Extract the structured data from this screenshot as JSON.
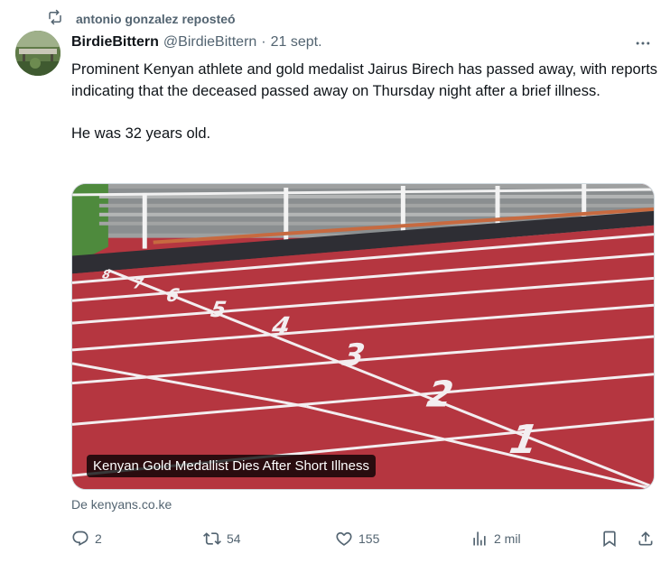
{
  "repost_banner": {
    "text": "antonio gonzalez reposteó",
    "icon": "repost-icon"
  },
  "author": {
    "display_name": "BirdieBittern",
    "handle": "@BirdieBittern",
    "separator": "·",
    "timestamp": "21 sept."
  },
  "tweet": {
    "text": "Prominent Kenyan athlete and gold medalist Jairus Birech has passed away, with reports indicating that the deceased passed away on Thursday night after a brief illness.\n\nHe was 32 years old."
  },
  "media": {
    "caption": "Kenyan Gold Medallist Dies After Short Illness",
    "lane_numbers": [
      "1",
      "2",
      "3",
      "4",
      "5",
      "6",
      "7",
      "8"
    ]
  },
  "source": {
    "text": "De kenyans.co.ke"
  },
  "actions": {
    "replies": "2",
    "reposts": "54",
    "likes": "155",
    "views": "2 mil"
  },
  "colors": {
    "text_primary": "#0f1419",
    "text_secondary": "#536471",
    "track_red": "#b53640",
    "track_lines": "#f3eef0",
    "caption_bg": "#000000"
  }
}
